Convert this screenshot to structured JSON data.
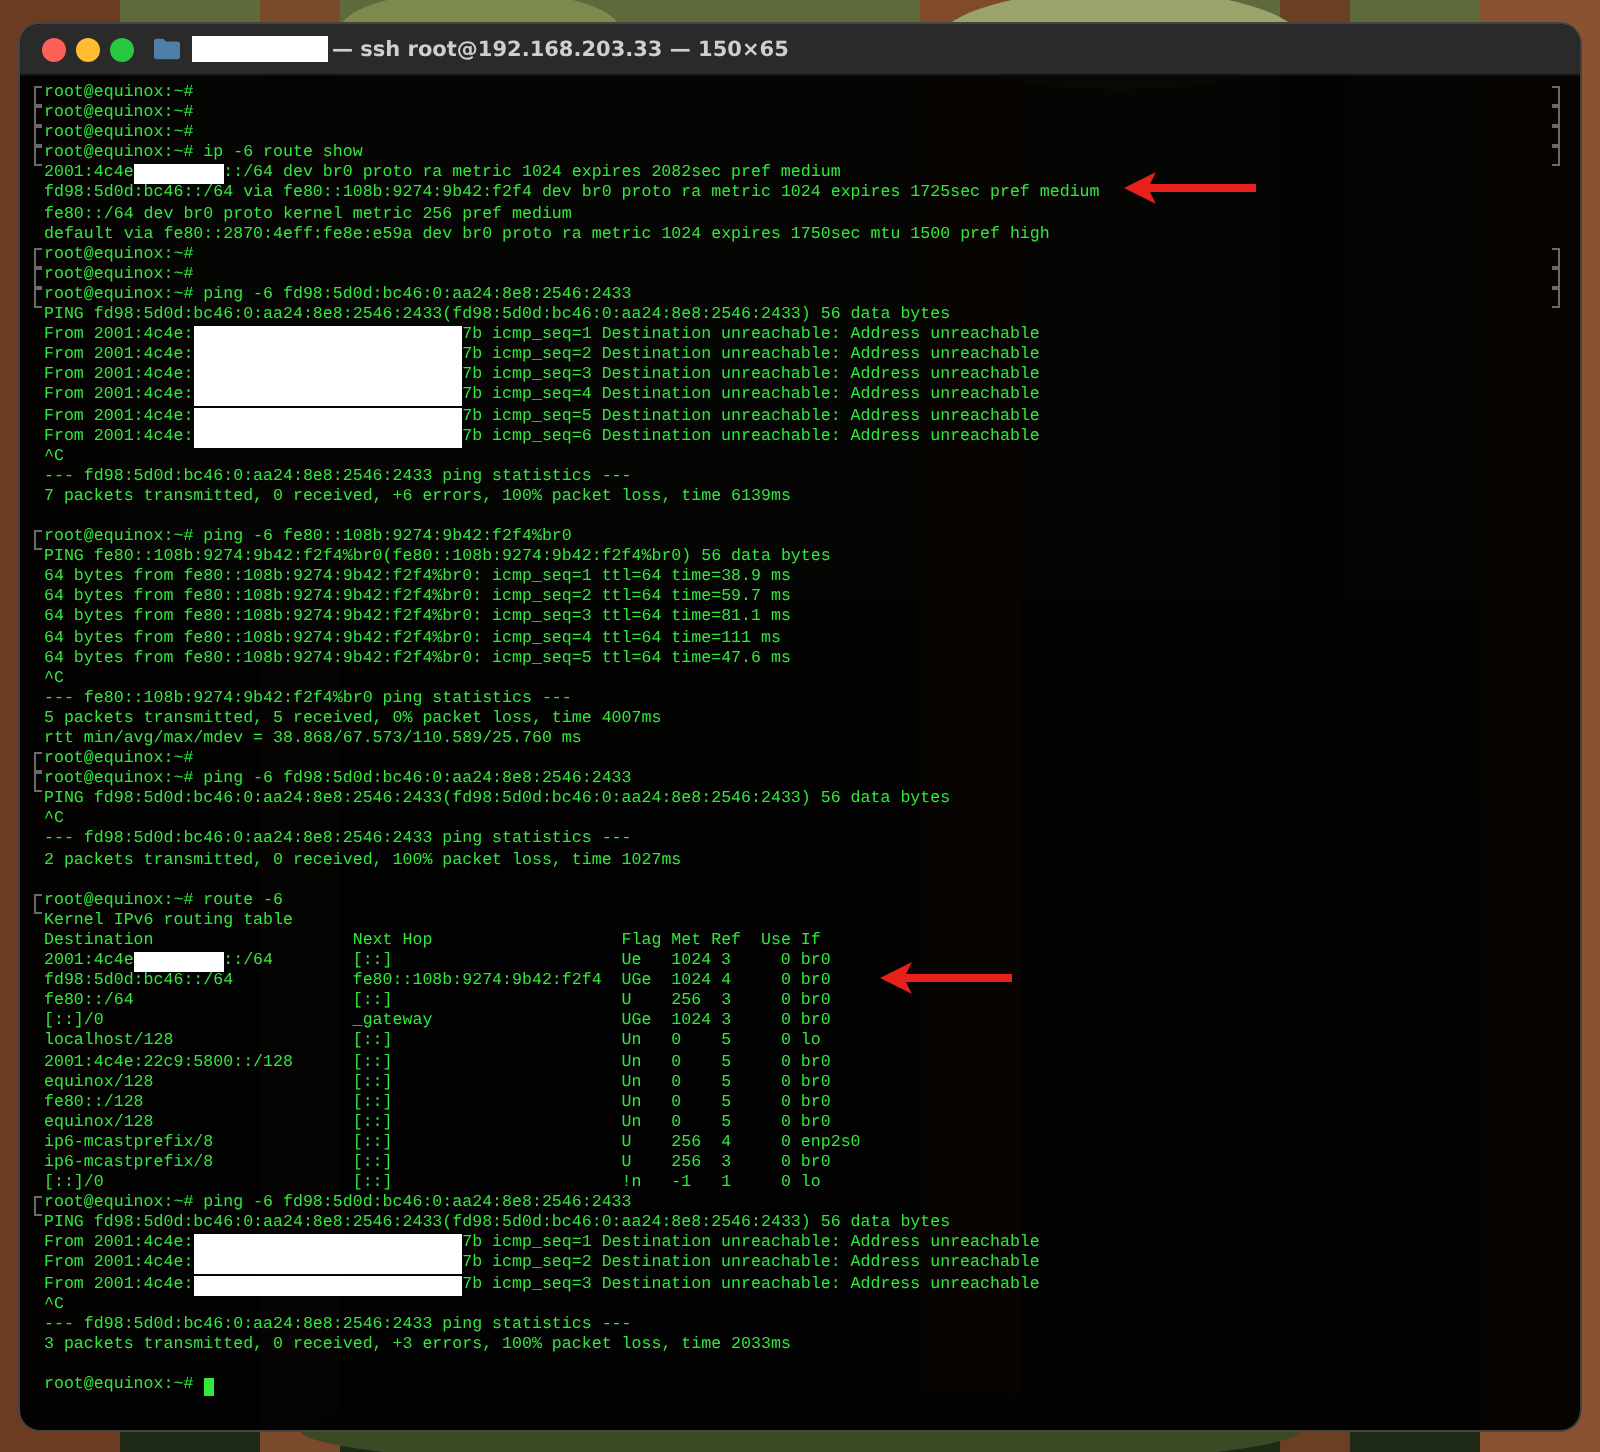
{
  "window": {
    "title_redacted": true,
    "title": "— ssh root@192.168.203.33 — 150×65"
  },
  "lines": [
    {
      "kind": "text",
      "mark_left": true,
      "mark_right": true,
      "text": "root@equinox:~#"
    },
    {
      "kind": "text",
      "mark_left": true,
      "mark_right": true,
      "text": "root@equinox:~#"
    },
    {
      "kind": "text",
      "mark_left": true,
      "mark_right": true,
      "text": "root@equinox:~#"
    },
    {
      "kind": "text",
      "mark_left": true,
      "mark_right": true,
      "text": "root@equinox:~# ip -6 route show"
    },
    {
      "kind": "redacted_short",
      "mark_left": false,
      "mark_right": false,
      "parts": [
        "2001:4c4e",
        "::/64 dev br0 proto ra metric 1024 expires 2082sec pref medium"
      ]
    },
    {
      "kind": "text",
      "mark_left": false,
      "mark_right": false,
      "text": "fd98:5d0d:bc46::/64 via fe80::108b:9274:9b42:f2f4 dev br0 proto ra metric 1024 expires 1725sec pref medium"
    },
    {
      "kind": "text",
      "mark_left": false,
      "mark_right": false,
      "text": "fe80::/64 dev br0 proto kernel metric 256 pref medium"
    },
    {
      "kind": "text",
      "mark_left": false,
      "mark_right": false,
      "text": "default via fe80::2870:4eff:fe8e:e59a dev br0 proto ra metric 1024 expires 1750sec mtu 1500 pref high"
    },
    {
      "kind": "text",
      "mark_left": true,
      "mark_right": true,
      "text": "root@equinox:~#"
    },
    {
      "kind": "text",
      "mark_left": true,
      "mark_right": true,
      "text": "root@equinox:~#"
    },
    {
      "kind": "text",
      "mark_left": true,
      "mark_right": true,
      "text": "root@equinox:~# ping -6 fd98:5d0d:bc46:0:aa24:8e8:2546:2433"
    },
    {
      "kind": "text",
      "mark_left": false,
      "mark_right": false,
      "text": "PING fd98:5d0d:bc46:0:aa24:8e8:2546:2433(fd98:5d0d:bc46:0:aa24:8e8:2546:2433) 56 data bytes"
    },
    {
      "kind": "redacted_long",
      "mark_left": false,
      "mark_right": false,
      "parts": [
        "From 2001:4c4e:",
        "7b icmp_seq=1 Destination unreachable: Address unreachable"
      ]
    },
    {
      "kind": "redacted_long",
      "mark_left": false,
      "mark_right": false,
      "parts": [
        "From 2001:4c4e:",
        "7b icmp_seq=2 Destination unreachable: Address unreachable"
      ]
    },
    {
      "kind": "redacted_long",
      "mark_left": false,
      "mark_right": false,
      "parts": [
        "From 2001:4c4e:",
        "7b icmp_seq=3 Destination unreachable: Address unreachable"
      ]
    },
    {
      "kind": "redacted_long",
      "mark_left": false,
      "mark_right": false,
      "parts": [
        "From 2001:4c4e:",
        "7b icmp_seq=4 Destination unreachable: Address unreachable"
      ]
    },
    {
      "kind": "redacted_long",
      "mark_left": false,
      "mark_right": false,
      "parts": [
        "From 2001:4c4e:",
        "7b icmp_seq=5 Destination unreachable: Address unreachable"
      ]
    },
    {
      "kind": "redacted_long",
      "mark_left": false,
      "mark_right": false,
      "parts": [
        "From 2001:4c4e:",
        "7b icmp_seq=6 Destination unreachable: Address unreachable"
      ]
    },
    {
      "kind": "text",
      "mark_left": false,
      "mark_right": false,
      "text": "^C"
    },
    {
      "kind": "text",
      "mark_left": false,
      "mark_right": false,
      "text": "--- fd98:5d0d:bc46:0:aa24:8e8:2546:2433 ping statistics ---"
    },
    {
      "kind": "text",
      "mark_left": false,
      "mark_right": false,
      "text": "7 packets transmitted, 0 received, +6 errors, 100% packet loss, time 6139ms"
    },
    {
      "kind": "blank"
    },
    {
      "kind": "text",
      "mark_left": true,
      "mark_right": false,
      "text": "root@equinox:~# ping -6 fe80::108b:9274:9b42:f2f4%br0"
    },
    {
      "kind": "text",
      "mark_left": false,
      "mark_right": false,
      "text": "PING fe80::108b:9274:9b42:f2f4%br0(fe80::108b:9274:9b42:f2f4%br0) 56 data bytes"
    },
    {
      "kind": "text",
      "mark_left": false,
      "mark_right": false,
      "text": "64 bytes from fe80::108b:9274:9b42:f2f4%br0: icmp_seq=1 ttl=64 time=38.9 ms"
    },
    {
      "kind": "text",
      "mark_left": false,
      "mark_right": false,
      "text": "64 bytes from fe80::108b:9274:9b42:f2f4%br0: icmp_seq=2 ttl=64 time=59.7 ms"
    },
    {
      "kind": "text",
      "mark_left": false,
      "mark_right": false,
      "text": "64 bytes from fe80::108b:9274:9b42:f2f4%br0: icmp_seq=3 ttl=64 time=81.1 ms"
    },
    {
      "kind": "text",
      "mark_left": false,
      "mark_right": false,
      "text": "64 bytes from fe80::108b:9274:9b42:f2f4%br0: icmp_seq=4 ttl=64 time=111 ms"
    },
    {
      "kind": "text",
      "mark_left": false,
      "mark_right": false,
      "text": "64 bytes from fe80::108b:9274:9b42:f2f4%br0: icmp_seq=5 ttl=64 time=47.6 ms"
    },
    {
      "kind": "text",
      "mark_left": false,
      "mark_right": false,
      "text": "^C"
    },
    {
      "kind": "text",
      "mark_left": false,
      "mark_right": false,
      "text": "--- fe80::108b:9274:9b42:f2f4%br0 ping statistics ---"
    },
    {
      "kind": "text",
      "mark_left": false,
      "mark_right": false,
      "text": "5 packets transmitted, 5 received, 0% packet loss, time 4007ms"
    },
    {
      "kind": "text",
      "mark_left": false,
      "mark_right": false,
      "text": "rtt min/avg/max/mdev = 38.868/67.573/110.589/25.760 ms"
    },
    {
      "kind": "text",
      "mark_left": true,
      "mark_right": false,
      "text": "root@equinox:~#"
    },
    {
      "kind": "text",
      "mark_left": true,
      "mark_right": false,
      "text": "root@equinox:~# ping -6 fd98:5d0d:bc46:0:aa24:8e8:2546:2433"
    },
    {
      "kind": "text",
      "mark_left": false,
      "mark_right": false,
      "text": "PING fd98:5d0d:bc46:0:aa24:8e8:2546:2433(fd98:5d0d:bc46:0:aa24:8e8:2546:2433) 56 data bytes"
    },
    {
      "kind": "text",
      "mark_left": false,
      "mark_right": false,
      "text": "^C"
    },
    {
      "kind": "text",
      "mark_left": false,
      "mark_right": false,
      "text": "--- fd98:5d0d:bc46:0:aa24:8e8:2546:2433 ping statistics ---"
    },
    {
      "kind": "text",
      "mark_left": false,
      "mark_right": false,
      "text": "2 packets transmitted, 0 received, 100% packet loss, time 1027ms"
    },
    {
      "kind": "blank"
    },
    {
      "kind": "text",
      "mark_left": true,
      "mark_right": false,
      "text": "root@equinox:~# route -6"
    },
    {
      "kind": "text",
      "mark_left": false,
      "mark_right": false,
      "text": "Kernel IPv6 routing table"
    },
    {
      "kind": "text",
      "mark_left": false,
      "mark_right": false,
      "text": "Destination                    Next Hop                   Flag Met Ref  Use If"
    },
    {
      "kind": "redacted_short",
      "mark_left": false,
      "mark_right": false,
      "parts": [
        "2001:4c4e",
        "::/64        [::]                       Ue   1024 3     0 br0"
      ]
    },
    {
      "kind": "text",
      "mark_left": false,
      "mark_right": false,
      "text": "fd98:5d0d:bc46::/64            fe80::108b:9274:9b42:f2f4  UGe  1024 4     0 br0"
    },
    {
      "kind": "text",
      "mark_left": false,
      "mark_right": false,
      "text": "fe80::/64                      [::]                       U    256  3     0 br0"
    },
    {
      "kind": "text",
      "mark_left": false,
      "mark_right": false,
      "text": "[::]/0                         _gateway                   UGe  1024 3     0 br0"
    },
    {
      "kind": "text",
      "mark_left": false,
      "mark_right": false,
      "text": "localhost/128                  [::]                       Un   0    5     0 lo"
    },
    {
      "kind": "text",
      "mark_left": false,
      "mark_right": false,
      "text": "2001:4c4e:22c9:5800::/128      [::]                       Un   0    5     0 br0"
    },
    {
      "kind": "text",
      "mark_left": false,
      "mark_right": false,
      "text": "equinox/128                    [::]                       Un   0    5     0 br0"
    },
    {
      "kind": "text",
      "mark_left": false,
      "mark_right": false,
      "text": "fe80::/128                     [::]                       Un   0    5     0 br0"
    },
    {
      "kind": "text",
      "mark_left": false,
      "mark_right": false,
      "text": "equinox/128                    [::]                       Un   0    5     0 br0"
    },
    {
      "kind": "text",
      "mark_left": false,
      "mark_right": false,
      "text": "ip6-mcastprefix/8              [::]                       U    256  4     0 enp2s0"
    },
    {
      "kind": "text",
      "mark_left": false,
      "mark_right": false,
      "text": "ip6-mcastprefix/8              [::]                       U    256  3     0 br0"
    },
    {
      "kind": "text",
      "mark_left": false,
      "mark_right": false,
      "text": "[::]/0                         [::]                       !n   -1   1     0 lo"
    },
    {
      "kind": "text",
      "mark_left": true,
      "mark_right": false,
      "text": "root@equinox:~# ping -6 fd98:5d0d:bc46:0:aa24:8e8:2546:2433"
    },
    {
      "kind": "text",
      "mark_left": false,
      "mark_right": false,
      "text": "PING fd98:5d0d:bc46:0:aa24:8e8:2546:2433(fd98:5d0d:bc46:0:aa24:8e8:2546:2433) 56 data bytes"
    },
    {
      "kind": "redacted_long",
      "mark_left": false,
      "mark_right": false,
      "parts": [
        "From 2001:4c4e:",
        "7b icmp_seq=1 Destination unreachable: Address unreachable"
      ]
    },
    {
      "kind": "redacted_long",
      "mark_left": false,
      "mark_right": false,
      "parts": [
        "From 2001:4c4e:",
        "7b icmp_seq=2 Destination unreachable: Address unreachable"
      ]
    },
    {
      "kind": "redacted_long",
      "mark_left": false,
      "mark_right": false,
      "parts": [
        "From 2001:4c4e:",
        "7b icmp_seq=3 Destination unreachable: Address unreachable"
      ]
    },
    {
      "kind": "text",
      "mark_left": false,
      "mark_right": false,
      "text": "^C"
    },
    {
      "kind": "text",
      "mark_left": false,
      "mark_right": false,
      "text": "--- fd98:5d0d:bc46:0:aa24:8e8:2546:2433 ping statistics ---"
    },
    {
      "kind": "text",
      "mark_left": false,
      "mark_right": false,
      "text": "3 packets transmitted, 0 received, +3 errors, 100% packet loss, time 2033ms"
    },
    {
      "kind": "blank"
    },
    {
      "kind": "input",
      "text": "root@equinox:~#"
    }
  ]
}
